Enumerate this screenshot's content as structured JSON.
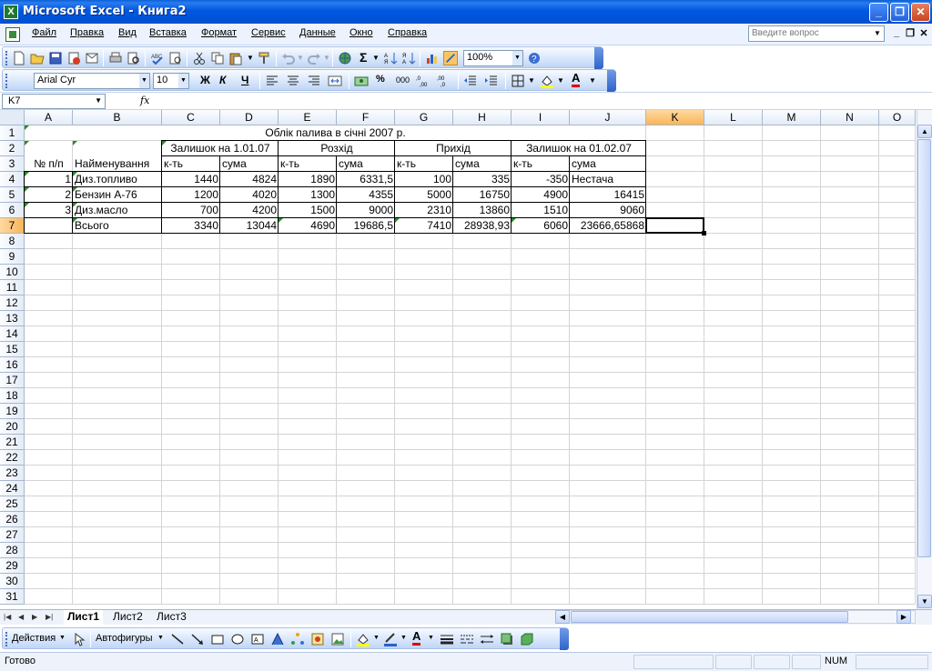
{
  "window": {
    "title": "Microsoft Excel - Книга2",
    "app_icon_letter": "X",
    "min_glyph": "_",
    "max_glyph": "❐",
    "close_glyph": "✕"
  },
  "menu": {
    "items": [
      "Файл",
      "Правка",
      "Вид",
      "Вставка",
      "Формат",
      "Сервис",
      "Данные",
      "Окно",
      "Справка"
    ],
    "ask_placeholder": "Введите вопрос",
    "mdi": [
      "_",
      "❐",
      "✕"
    ]
  },
  "toolbar_standard": {
    "zoom": "100%"
  },
  "toolbar_format": {
    "font": "Arial Cyr",
    "size": "10",
    "bold": "Ж",
    "italic": "К",
    "underline": "Ч",
    "percent": "%",
    "thousands": "000"
  },
  "formula_bar": {
    "name_box": "K7",
    "fx": "fx",
    "value": ""
  },
  "grid": {
    "columns": [
      "A",
      "B",
      "C",
      "D",
      "E",
      "F",
      "G",
      "H",
      "I",
      "J",
      "K",
      "L",
      "M",
      "N",
      "O"
    ],
    "rows": [
      "1",
      "2",
      "3",
      "4",
      "5",
      "6",
      "7",
      "8",
      "9",
      "10",
      "11",
      "12",
      "13",
      "14",
      "15",
      "16",
      "17",
      "18",
      "19",
      "20",
      "21",
      "22",
      "23",
      "24",
      "25",
      "26",
      "27",
      "28",
      "29",
      "30",
      "31"
    ],
    "selected_cell": "K7"
  },
  "sheet": {
    "title": "Облік палива в січні 2007 р.",
    "group_headers": [
      "Залишок на 1.01.07",
      "Розхід",
      "Прихід",
      "Залишок на 01.02.07"
    ],
    "sub_headers": [
      "№ п/п",
      "Найменування",
      "к-ть",
      "сума",
      "к-ть",
      "сума",
      "к-ть",
      "сума",
      "к-ть",
      "сума"
    ],
    "rows": [
      [
        "1",
        "Диз.топливо",
        "1440",
        "4824",
        "1890",
        "6331,5",
        "100",
        "335",
        "-350",
        "Нестача"
      ],
      [
        "2",
        "Бензин А-76",
        "1200",
        "4020",
        "1300",
        "4355",
        "5000",
        "16750",
        "4900",
        "16415"
      ],
      [
        "3",
        "Диз.масло",
        "700",
        "4200",
        "1500",
        "9000",
        "2310",
        "13860",
        "1510",
        "9060"
      ],
      [
        "",
        "Всього",
        "3340",
        "13044",
        "4690",
        "19686,5",
        "7410",
        "28938,93",
        "6060",
        "23666,65868"
      ]
    ]
  },
  "tabs": {
    "sheets": [
      "Лист1",
      "Лист2",
      "Лист3"
    ],
    "active": "Лист1"
  },
  "drawing_toolbar": {
    "actions": "Действия",
    "autoshapes": "Автофигуры"
  },
  "status": {
    "ready": "Готово",
    "num": "NUM"
  }
}
